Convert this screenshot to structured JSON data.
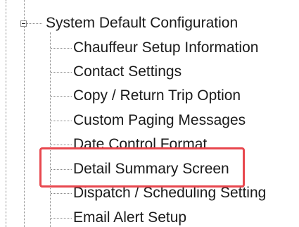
{
  "tree": {
    "root": {
      "label": "System Default Configuration",
      "expander_state": "expanded"
    },
    "children": [
      {
        "label": "Chauffeur Setup Information"
      },
      {
        "label": "Contact Settings"
      },
      {
        "label": "Copy / Return Trip Option"
      },
      {
        "label": "Custom Paging Messages"
      },
      {
        "label": "Date Control Format"
      },
      {
        "label": "Detail Summary Screen"
      },
      {
        "label": "Dispatch / Scheduling Setting"
      },
      {
        "label": "Email Alert Setup"
      }
    ]
  },
  "colors": {
    "highlight_border": "#e8474e",
    "connector": "#8a8a8a",
    "text": "#1a1a1a"
  }
}
